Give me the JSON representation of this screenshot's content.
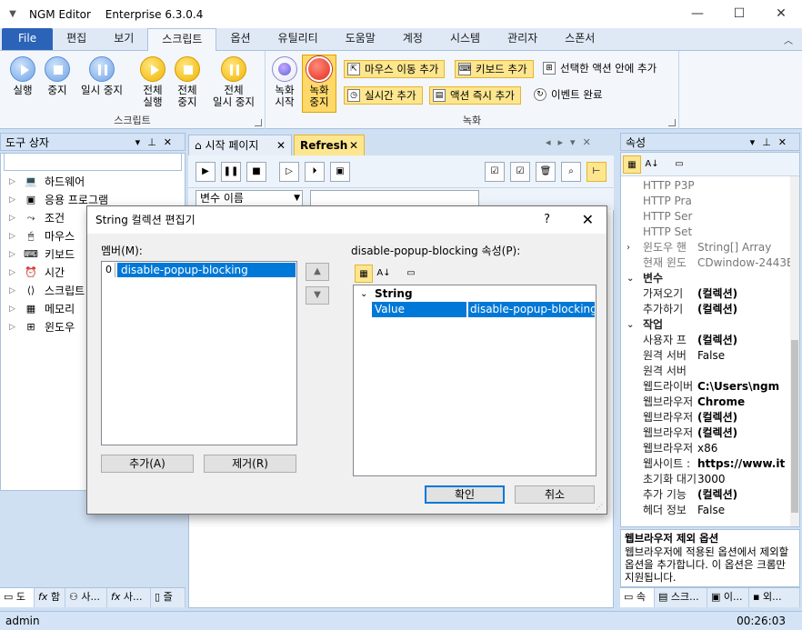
{
  "window": {
    "app_name": "NGM Editor",
    "edition": "Enterprise 6.3.0.4",
    "minimize": "—",
    "maximize": "☐",
    "close": "✕"
  },
  "ribbon_tabs": [
    "File",
    "편집",
    "보기",
    "스크립트",
    "옵션",
    "유틸리티",
    "도움말",
    "계정",
    "시스템",
    "관리자",
    "스폰서"
  ],
  "active_ribbon_tab": "스크립트",
  "ribbon": {
    "script_group": {
      "label": "스크립트",
      "buttons": [
        {
          "label": "실행",
          "icon": "play-icon"
        },
        {
          "label": "중지",
          "icon": "stop-icon"
        },
        {
          "label": "일시 중지",
          "icon": "pause-icon"
        },
        {
          "label": "전체\n실행",
          "icon": "play-all-icon"
        },
        {
          "label": "전체\n중지",
          "icon": "stop-all-icon"
        },
        {
          "label": "전체\n일시 중지",
          "icon": "pause-all-icon"
        }
      ]
    },
    "record_group": {
      "label": "녹화",
      "buttons": [
        {
          "label": "녹화\n시작",
          "icon": "record-start-icon"
        },
        {
          "label": "녹화\n중지",
          "icon": "record-stop-icon"
        }
      ],
      "small_buttons": [
        {
          "label": "마우스 이동 추가",
          "icon": "mouse-move-icon"
        },
        {
          "label": "키보드 추가",
          "icon": "keyboard-icon"
        },
        {
          "label": "선택한 액션 안에 추가",
          "icon": "nest-action-icon"
        },
        {
          "label": "실시간 추가",
          "icon": "realtime-icon"
        },
        {
          "label": "액션 즉시 추가",
          "icon": "instant-action-icon"
        },
        {
          "label": "이벤트 완료",
          "icon": "event-complete-icon"
        }
      ]
    }
  },
  "toolbox": {
    "title": "도구 상자",
    "items": [
      {
        "label": "하드웨어",
        "icon": "hardware-icon"
      },
      {
        "label": "응용 프로그램",
        "icon": "application-icon"
      },
      {
        "label": "조건",
        "icon": "condition-icon"
      },
      {
        "label": "마우스",
        "icon": "mouse-icon"
      },
      {
        "label": "키보드",
        "icon": "keyboard-icon"
      },
      {
        "label": "시간",
        "icon": "clock-icon"
      },
      {
        "label": "스크립트",
        "icon": "script-icon"
      },
      {
        "label": "메모리",
        "icon": "memory-icon"
      },
      {
        "label": "윈도우",
        "icon": "windows-icon"
      }
    ],
    "bottom_tabs": [
      "도",
      "함",
      "사...",
      "사...",
      "즐"
    ]
  },
  "documents": {
    "tabs": [
      {
        "label": "시작 페이지",
        "active": false
      },
      {
        "label": "Refresh",
        "active": true
      }
    ],
    "variable_select": "변수 이름"
  },
  "properties": {
    "title": "속성",
    "rows": [
      {
        "type": "grey",
        "name": "HTTP P3P",
        "value": ""
      },
      {
        "type": "grey",
        "name": "HTTP Pra",
        "value": ""
      },
      {
        "type": "grey",
        "name": "HTTP Ser",
        "value": ""
      },
      {
        "type": "grey",
        "name": "HTTP Set",
        "value": ""
      },
      {
        "type": "grey",
        "name": "윈도우 핸",
        "value": "String[] Array",
        "exp": "›"
      },
      {
        "type": "grey",
        "name": "현재 윈도",
        "value": "CDwindow-2443E"
      },
      {
        "type": "cat",
        "name": "변수",
        "exp": "⌄"
      },
      {
        "type": "row",
        "name": "가져오기",
        "value": "(컬렉션)",
        "bold": true
      },
      {
        "type": "row",
        "name": "추가하기",
        "value": "(컬렉션)",
        "bold": true
      },
      {
        "type": "cat",
        "name": "작업",
        "exp": "⌄"
      },
      {
        "type": "row",
        "name": "사용자 프",
        "value": "(컬렉션)",
        "bold": true
      },
      {
        "type": "row",
        "name": "원격 서버",
        "value": "False"
      },
      {
        "type": "row",
        "name": "원격 서버",
        "value": ""
      },
      {
        "type": "row",
        "name": "웹드라이버",
        "value": "C:\\Users\\ngm",
        "bold": true
      },
      {
        "type": "row",
        "name": "웹브라우저",
        "value": "Chrome",
        "bold": true
      },
      {
        "type": "row",
        "name": "웹브라우저",
        "value": "(컬렉션)",
        "bold": true
      },
      {
        "type": "row",
        "name": "웹브라우저",
        "value": "(컬렉션)",
        "bold": true
      },
      {
        "type": "row",
        "name": "웹브라우저",
        "value": "x86"
      },
      {
        "type": "row",
        "name": "웹사이트 :",
        "value": "https://www.it",
        "bold": true
      },
      {
        "type": "row",
        "name": "초기화 대기",
        "value": "3000"
      },
      {
        "type": "row",
        "name": "추가 기능",
        "value": "(컬렉션)",
        "bold": true
      },
      {
        "type": "row",
        "name": "헤더 정보",
        "value": "False"
      }
    ],
    "desc_title": "웹브라우저 제외 옵션",
    "desc_text": "웹브라우저에 적용된 옵션에서 제외할 옵션을 추가합니다. 이 옵션은 크롬만 지원됩니다.",
    "bottom_tabs": [
      "속",
      "스크...",
      "이...",
      "외..."
    ]
  },
  "status": {
    "user": "admin",
    "time": "00:26:03"
  },
  "dialog": {
    "title": "String 컬렉션 편집기",
    "help": "?",
    "close": "✕",
    "members_label": "멤버(M):",
    "members": [
      {
        "index": "0",
        "value": "disable-popup-blocking"
      }
    ],
    "props_label": "disable-popup-blocking 속성(P):",
    "grid_category": "String",
    "grid_row": {
      "name": "Value",
      "value": "disable-popup-blocking"
    },
    "add_button": "추가(A)",
    "remove_button": "제거(R)",
    "ok_button": "확인",
    "cancel_button": "취소"
  }
}
